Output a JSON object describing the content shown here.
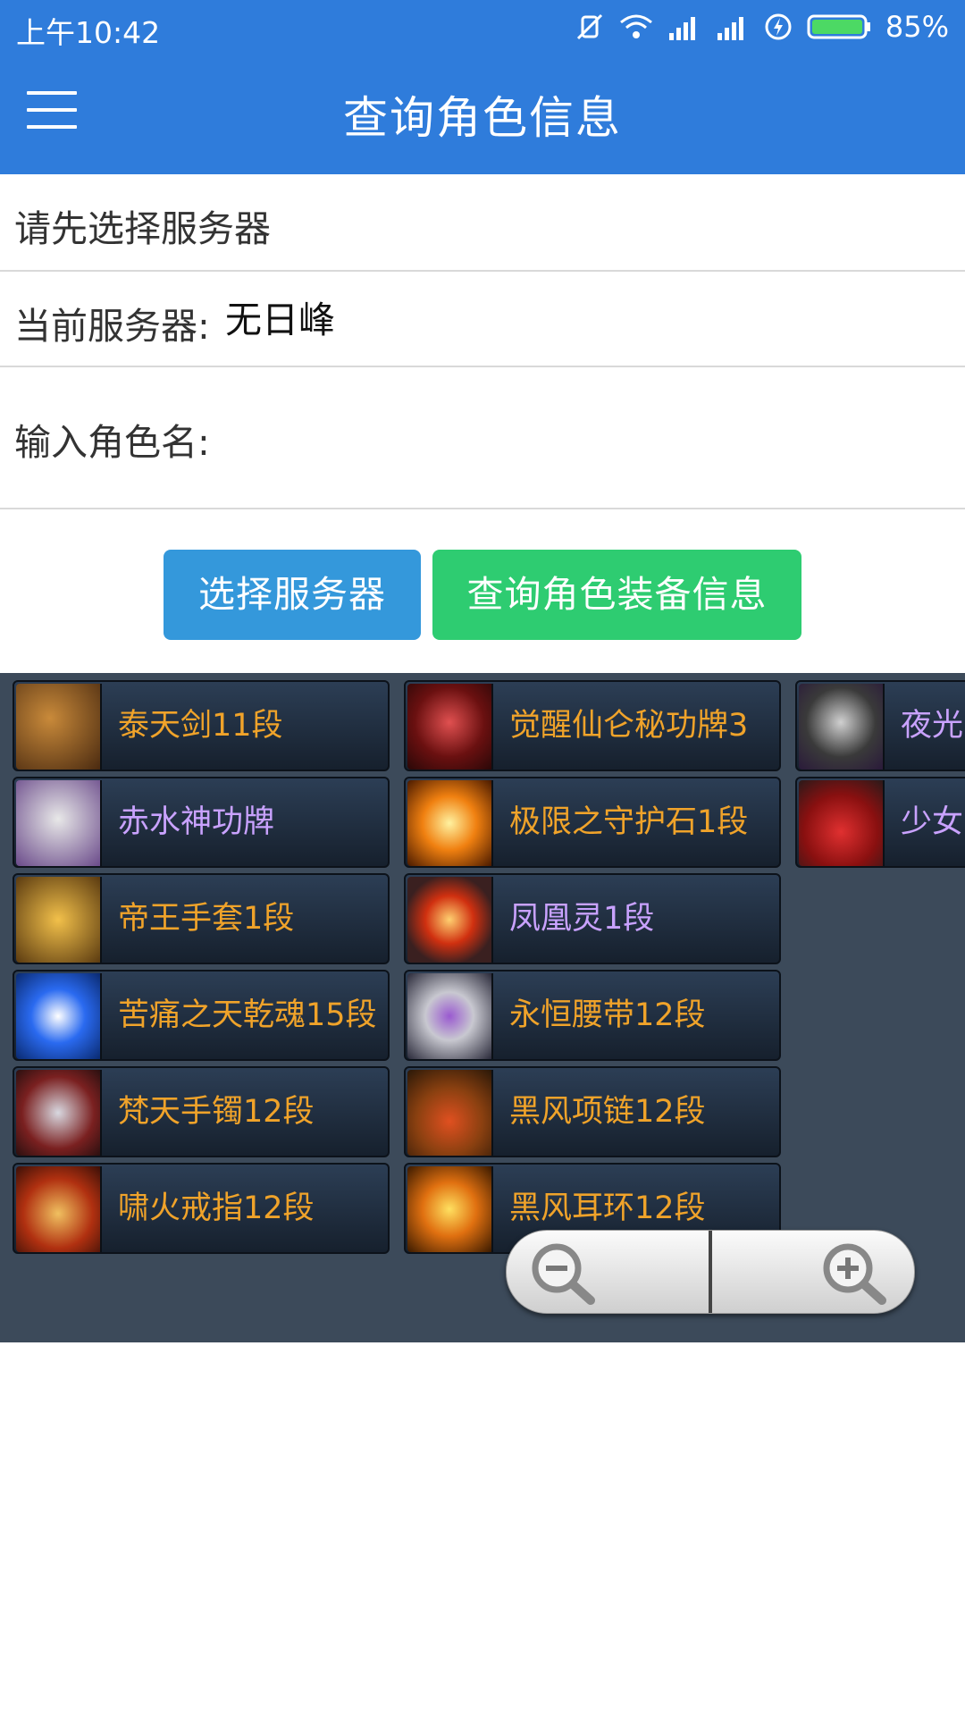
{
  "status_bar": {
    "time": "上午10:42",
    "battery_percent": "85%"
  },
  "app_bar": {
    "title": "查询角色信息",
    "menu_icon": "hamburger-menu-icon"
  },
  "form": {
    "prompt": "请先选择服务器",
    "current_server_label": "当前服务器:",
    "current_server_value": "无日峰",
    "role_name_label": "输入角色名:",
    "role_name_value": ""
  },
  "buttons": {
    "select_server": "选择服务器",
    "query_equipment": "查询角色装备信息"
  },
  "equipment": {
    "column1": [
      {
        "name": "泰天剑11段",
        "color": "#f0a32a",
        "icon": "sword-icon"
      },
      {
        "name": "赤水神功牌",
        "color": "#c9a2ff",
        "icon": "badge-icon"
      },
      {
        "name": "帝王手套1段",
        "color": "#f0a32a",
        "icon": "glove-icon"
      },
      {
        "name": "苦痛之天乾魂15段",
        "color": "#f0a32a",
        "icon": "soul-orb-icon"
      },
      {
        "name": "梵天手镯12段",
        "color": "#f0a32a",
        "icon": "bracelet-icon"
      },
      {
        "name": "啸火戒指12段",
        "color": "#f0a32a",
        "icon": "ring-icon"
      }
    ],
    "column2": [
      {
        "name": "觉醒仙仑秘功牌3",
        "color": "#f0a32a",
        "icon": "talisman-icon"
      },
      {
        "name": "极限之守护石1段",
        "color": "#f0a32a",
        "icon": "gem-icon"
      },
      {
        "name": "凤凰灵1段",
        "color": "#c9a2ff",
        "icon": "phoenix-orb-icon"
      },
      {
        "name": "永恒腰带12段",
        "color": "#f0a32a",
        "icon": "belt-icon"
      },
      {
        "name": "黑风项链12段",
        "color": "#f0a32a",
        "icon": "necklace-icon"
      },
      {
        "name": "黑风耳环12段",
        "color": "#f0a32a",
        "icon": "earring-icon"
      }
    ],
    "column3": [
      {
        "name": "夜光",
        "color": "#c9a2ff",
        "icon": "hair-icon"
      },
      {
        "name": "少女",
        "color": "#c9a2ff",
        "icon": "outfit-icon"
      }
    ]
  },
  "zoom_control": {
    "zoom_out_icon": "zoom-out-icon",
    "zoom_in_icon": "zoom-in-icon"
  }
}
